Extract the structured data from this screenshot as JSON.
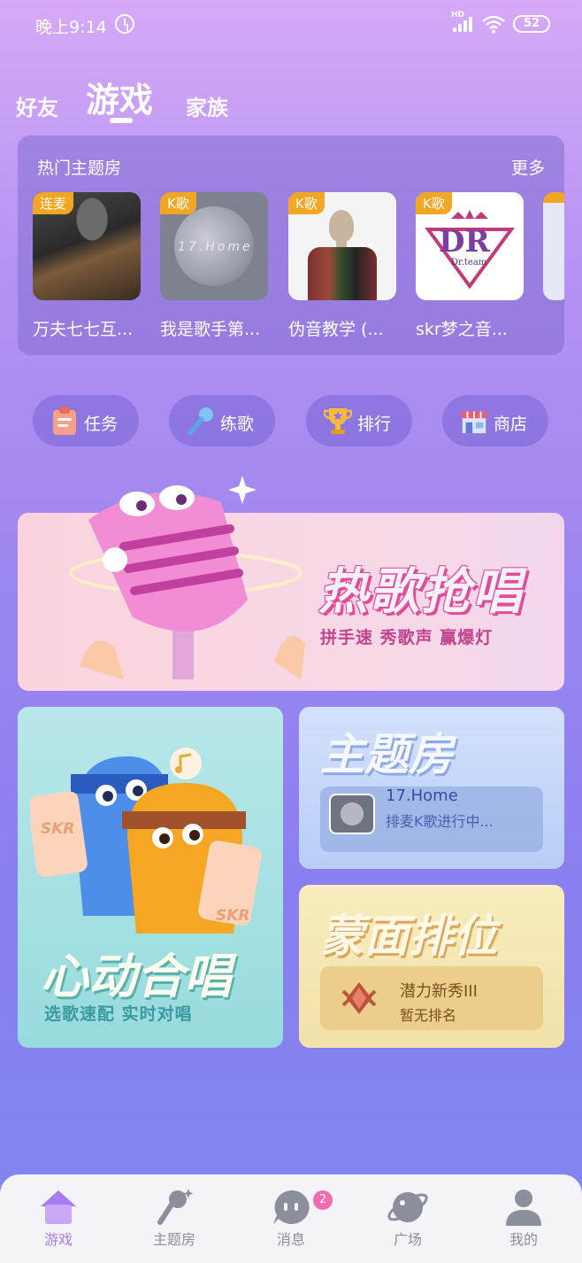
{
  "status_bar": {
    "time": "晚上9:14",
    "network": "HD",
    "battery": "52"
  },
  "tabs": [
    {
      "label": "好友"
    },
    {
      "label": "游戏"
    },
    {
      "label": "家族"
    }
  ],
  "hot_rooms": {
    "title": "热门主题房",
    "more_label": "更多",
    "rooms": [
      {
        "badge": "连麦",
        "name": "万夫七七互..."
      },
      {
        "badge": "K歌",
        "name": "我是歌手第...",
        "thumb_text": "17.Home"
      },
      {
        "badge": "K歌",
        "name": "伪音教学 (..."
      },
      {
        "badge": "K歌",
        "name": "skr梦之音...",
        "thumb_text": "DR",
        "thumb_subtext": "Dr.team"
      }
    ]
  },
  "quick_actions": [
    {
      "label": "任务",
      "icon": "clipboard-icon"
    },
    {
      "label": "练歌",
      "icon": "microphone-icon"
    },
    {
      "label": "排行",
      "icon": "trophy-icon"
    },
    {
      "label": "商店",
      "icon": "shop-icon"
    }
  ],
  "banner": {
    "title": "热歌抢唱",
    "subtitle": "拼手速 秀歌声 赢爆灯"
  },
  "duet_card": {
    "title": "心动合唱",
    "subtitle": "选歌速配 实时对唱",
    "badge_text": "SKR"
  },
  "theme_card": {
    "title": "主题房",
    "room_name": "17.Home",
    "room_status": "排麦K歌进行中..."
  },
  "mask_card": {
    "title": "蒙面排位",
    "rank_name": "潜力新秀III",
    "rank_status": "暂无排名"
  },
  "bottom_nav": [
    {
      "label": "游戏",
      "icon": "home-icon",
      "active": true
    },
    {
      "label": "主题房",
      "icon": "mic-nav-icon"
    },
    {
      "label": "消息",
      "icon": "chat-icon",
      "badge": "2"
    },
    {
      "label": "广场",
      "icon": "planet-icon"
    },
    {
      "label": "我的",
      "icon": "profile-icon"
    }
  ],
  "colors": {
    "accent": "#a67cf0",
    "badge": "#f3a622",
    "nav_badge": "#f06bb0"
  }
}
